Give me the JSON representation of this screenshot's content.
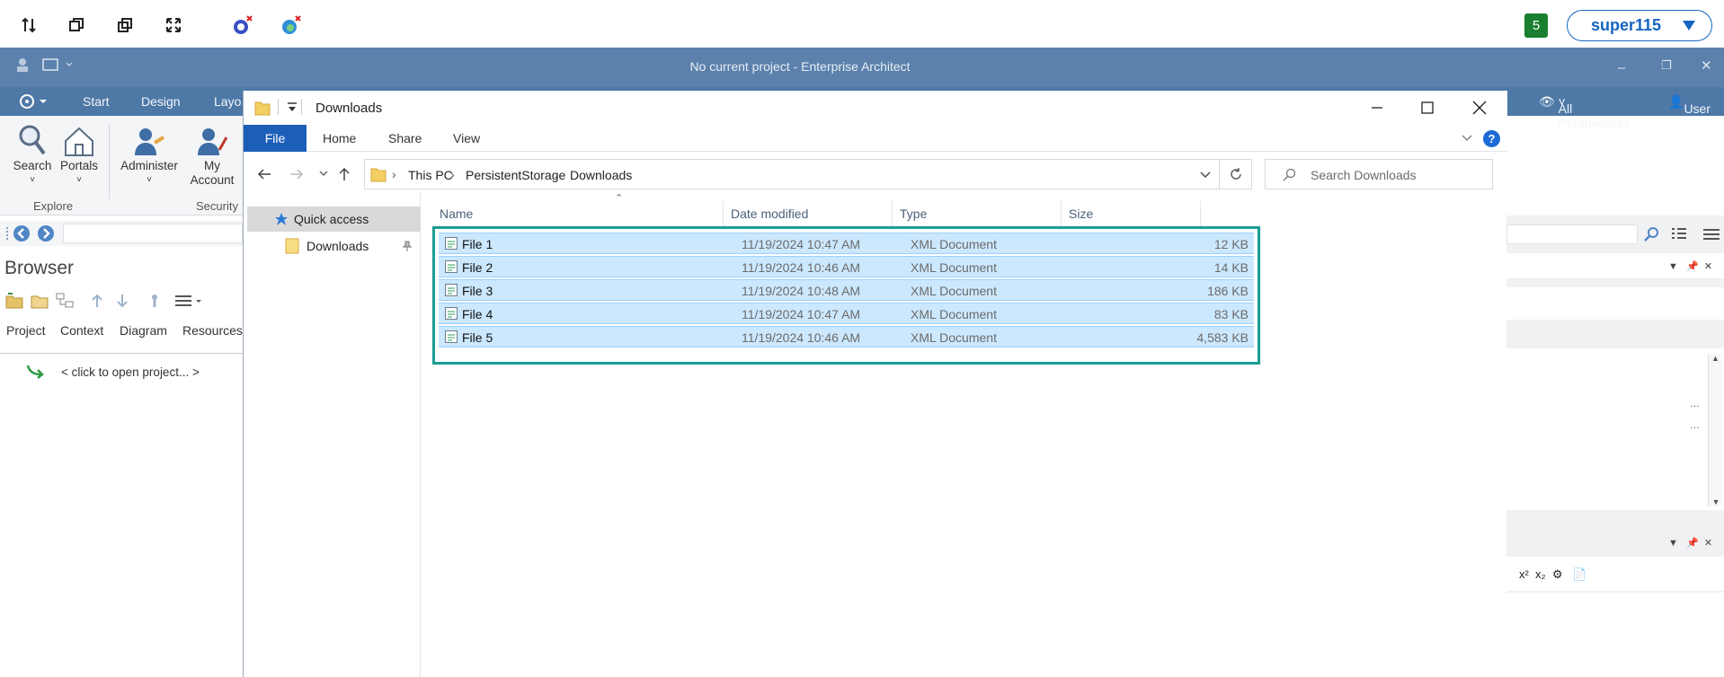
{
  "topbar": {
    "icons": [
      "sort-arrows-icon",
      "restore-window-icon",
      "duplicate-window-icon",
      "fullscreen-icon",
      "app-disconnected-icon",
      "browser-disconnected-icon"
    ],
    "badge_count": "5",
    "username": "super115"
  },
  "ea": {
    "window_title": "No current project - Enterprise Architect",
    "ribbon_tabs": [
      "Start",
      "Design",
      "Layo"
    ],
    "perspectives_label": "All Perspectives",
    "user_label": "User",
    "ribbon_buttons": {
      "search": "Search",
      "portals": "Portals",
      "administer": "Administer",
      "my_account_line1": "My",
      "my_account_line2": "Account"
    },
    "groups": {
      "explore": "Explore",
      "security": "Security"
    },
    "browser": {
      "title": "Browser",
      "tabs": [
        "Project",
        "Context",
        "Diagram",
        "Resources"
      ],
      "open_project_text": "< click to open project... >"
    }
  },
  "explorer": {
    "title": "Downloads",
    "tabs": {
      "file": "File",
      "home": "Home",
      "share": "Share",
      "view": "View"
    },
    "breadcrumb": [
      "This PC",
      "PersistentStorage",
      "Downloads"
    ],
    "search_placeholder": "Search Downloads",
    "nav": {
      "quick_access": "Quick access",
      "downloads": "Downloads"
    },
    "columns": {
      "name": "Name",
      "date": "Date modified",
      "type": "Type",
      "size": "Size"
    },
    "files": [
      {
        "name": "File 1",
        "date": "11/19/2024 10:47 AM",
        "type": "XML Document",
        "size": "12 KB"
      },
      {
        "name": "File 2",
        "date": "11/19/2024 10:46 AM",
        "type": "XML Document",
        "size": "14 KB"
      },
      {
        "name": "File 3",
        "date": "11/19/2024 10:48 AM",
        "type": "XML Document",
        "size": "186 KB"
      },
      {
        "name": "File 4",
        "date": "11/19/2024 10:47 AM",
        "type": "XML Document",
        "size": "83 KB"
      },
      {
        "name": "File 5",
        "date": "11/19/2024 10:46 AM",
        "type": "XML Document",
        "size": "4,583 KB"
      }
    ]
  },
  "colors": {
    "accent_blue": "#1c5fb8",
    "selection": "#cce8ff",
    "highlight_border": "#1d9e93",
    "ea_title_bg": "#5b81ac"
  }
}
